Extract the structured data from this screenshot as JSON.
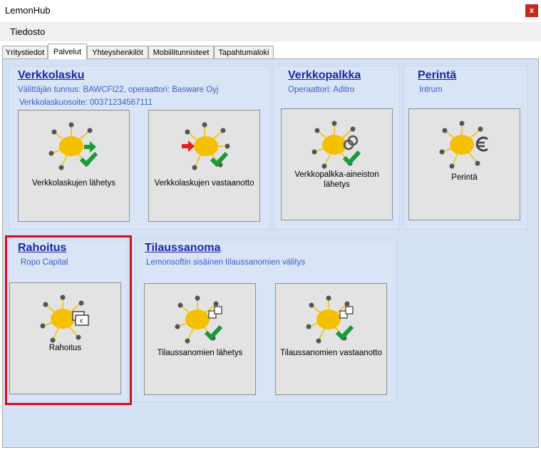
{
  "window": {
    "title": "LemonHub",
    "close_label": "x"
  },
  "menu": {
    "items": [
      "Tiedosto"
    ]
  },
  "tabs": [
    "Yritystiedot",
    "Palvelut",
    "Yhteyshenkilöt",
    "Mobiilitunnisteet",
    "Tapahtumaloki"
  ],
  "active_tab": "Palvelut",
  "groups": {
    "verkkolasku": {
      "title": "Verkkolasku",
      "sub1": "Välittäjän tunnus: BAWCFI22, operaattori: Basware Oyj",
      "sub2": "Verkkolaskuosoite: 00371234567111",
      "tiles": [
        "Verkkolaskujen lähetys",
        "Verkkolaskujen vastaanotto"
      ]
    },
    "verkkopalkka": {
      "title": "Verkkopalkka",
      "sub1": "Operaattori: Aditro",
      "tile_line1": "Verkkopalkka-aineiston",
      "tile_line2": "lähetys"
    },
    "perinta": {
      "title": "Perintä",
      "sub1": "Intrum",
      "tile": "Perintä"
    },
    "rahoitus": {
      "title": "Rahoitus",
      "sub1": "Ropo Capital",
      "tile": "Rahoitus"
    },
    "tilaussanoma": {
      "title": "Tilaussanoma",
      "sub1": "Lemonsoftin sisäinen tilaussanomien välitys",
      "tiles": [
        "Tilaussanomien lähetys",
        "Tilaussanomien vastaanotto"
      ]
    }
  },
  "icons": {
    "send": "sun-send-arrow-check-icon",
    "receive": "sun-receive-arrow-check-icon",
    "payroll": "sun-link-check-icon",
    "collection": "sun-euro-icon",
    "financing": "sun-wallet-icon",
    "order_send": "sun-box-check-icon",
    "order_receive": "sun-box-check-icon"
  },
  "colors": {
    "sun": "#f5c000",
    "check": "#1a9a3a",
    "send_arrow": "#1a9a3a",
    "receive_arrow": "#e02020",
    "group_title": "#1a2aa8",
    "subtitle": "#3a5fc4",
    "highlight": "#d0101a"
  }
}
